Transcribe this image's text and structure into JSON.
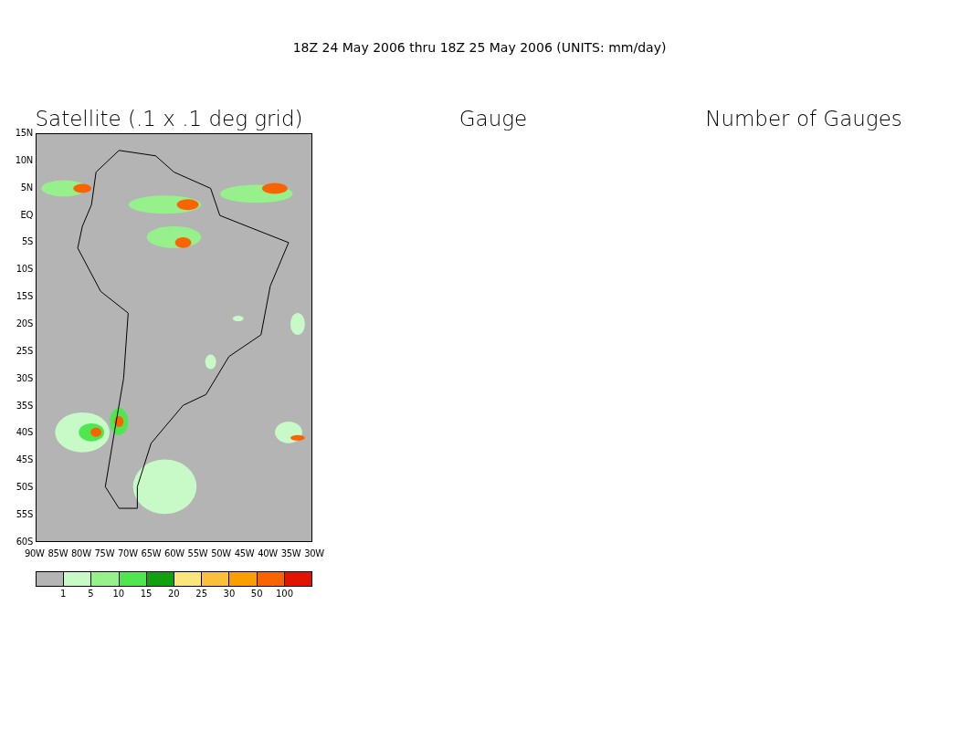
{
  "header": {
    "title": "18Z 24 May 2006 thru 18Z 25 May 2006 (UNITS: mm/day)"
  },
  "panels": [
    {
      "title": "Satellite (.1 x .1 deg grid)"
    },
    {
      "title": "Gauge"
    },
    {
      "title": "Number of Gauges"
    }
  ],
  "map": {
    "lat_labels": [
      "15N",
      "10N",
      "5N",
      "EQ",
      "5S",
      "10S",
      "15S",
      "20S",
      "25S",
      "30S",
      "35S",
      "40S",
      "45S",
      "50S",
      "55S",
      "60S"
    ],
    "lon_labels": [
      "90W",
      "85W",
      "80W",
      "75W",
      "70W",
      "65W",
      "60W",
      "55W",
      "50W",
      "45W",
      "40W",
      "35W",
      "30W"
    ]
  },
  "legend": {
    "swatches": [
      {
        "color": "#b4b4b4"
      },
      {
        "color": "#c8fac8"
      },
      {
        "color": "#96f08c"
      },
      {
        "color": "#50e650"
      },
      {
        "color": "#10a010"
      },
      {
        "color": "#fae67a"
      },
      {
        "color": "#fac03c"
      },
      {
        "color": "#fa9f00"
      },
      {
        "color": "#fa6400"
      },
      {
        "color": "#e01400"
      }
    ],
    "labels": [
      "1",
      "5",
      "10",
      "15",
      "20",
      "25",
      "30",
      "50",
      "100"
    ]
  }
}
